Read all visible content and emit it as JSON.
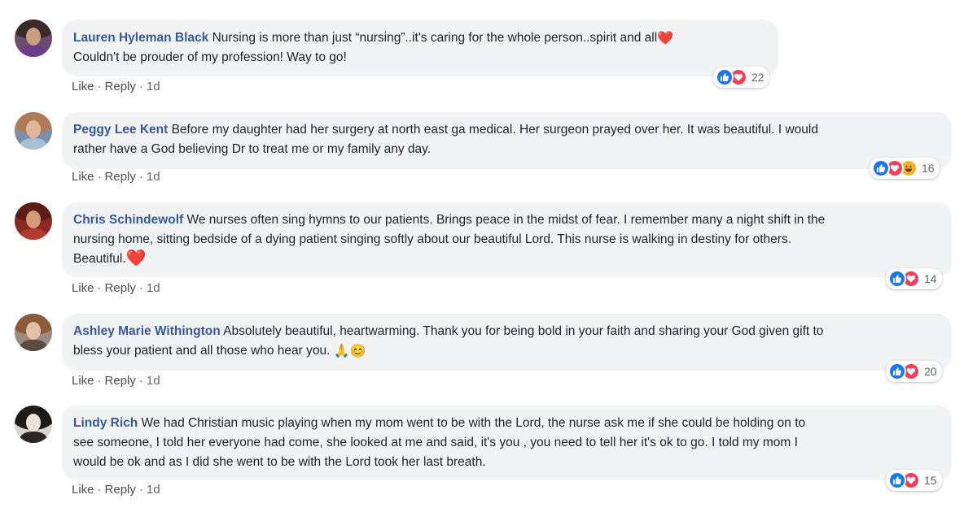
{
  "colors": {
    "author_link": "#385898",
    "bubble_bg": "#f2f3f5",
    "like_blue": "#1877f2",
    "love_red": "#f33e58",
    "haha_yellow": "#f7b125"
  },
  "comments": [
    {
      "author": "Lauren Hyleman Black",
      "text_1": "Nursing is more than just “nursing”..it's caring for the whole person..spirit and all",
      "emoji_1": "❤️",
      "text_2": "Couldn't be prouder of my profession! Way to go!",
      "like": "Like",
      "reply": "Reply",
      "time": "1d",
      "reaction_count": "22",
      "reactions": [
        "like-icon",
        "love-icon"
      ]
    },
    {
      "author": "Peggy Lee Kent",
      "text_1": "Before my daughter had her surgery at north east ga medical. Her surgeon prayed over her. It was beautiful. I would",
      "text_2": "rather have a God believing Dr to treat me or my family any day.",
      "like": "Like",
      "reply": "Reply",
      "time": "1d",
      "reaction_count": "16",
      "reactions": [
        "like-icon",
        "love-icon",
        "haha-icon"
      ]
    },
    {
      "author": "Chris Schindewolf",
      "text_1": "We nurses often sing hymns to our patients. Brings peace in the midst of fear. I remember many a night shift in the",
      "text_2": "nursing home, sitting bedside of a dying patient singing softly about our beautiful Lord. This nurse is walking in destiny for others.",
      "text_3": "Beautiful.",
      "emoji_1": "❤️",
      "like": "Like",
      "reply": "Reply",
      "time": "1d",
      "reaction_count": "14",
      "reactions": [
        "like-icon",
        "love-icon"
      ]
    },
    {
      "author": "Ashley Marie Withington",
      "text_1": "Absolutely beautiful, heartwarming. Thank you for being bold in your faith and sharing your God given gift to",
      "text_2": "bless your patient and all those who hear you.",
      "emoji_1": "🙏",
      "emoji_2": "😊",
      "like": "Like",
      "reply": "Reply",
      "time": "1d",
      "reaction_count": "20",
      "reactions": [
        "like-icon",
        "love-icon"
      ]
    },
    {
      "author": "Lindy Rich",
      "text_1": "We had Christian music playing when my mom went to be with the Lord, the nurse ask me if she could be holding on to",
      "text_2": "see someone, I told her everyone had come, she looked at me and said, it's you , you need to tell her it's ok to go. I told my mom I",
      "text_3": "would be ok and as I did she went to be with the Lord took her last breath.",
      "like": "Like",
      "reply": "Reply",
      "time": "1d",
      "reaction_count": "15",
      "reactions": [
        "like-icon",
        "love-icon"
      ]
    }
  ]
}
